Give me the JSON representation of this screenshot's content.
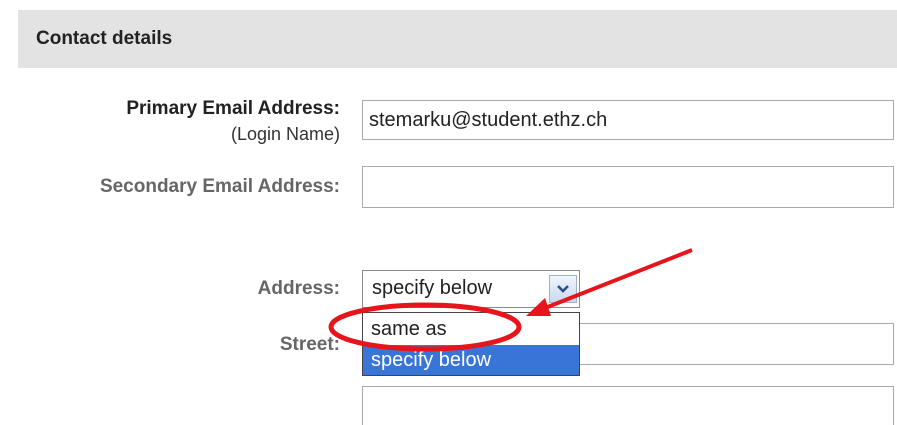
{
  "section": {
    "title": "Contact details"
  },
  "fields": {
    "primary_email": {
      "label": "Primary Email Address:",
      "sublabel": "(Login Name)",
      "value": "stemarku@student.ethz.ch"
    },
    "secondary_email": {
      "label": "Secondary Email Address:",
      "value": ""
    },
    "address": {
      "label": "Address:",
      "selected": "specify below",
      "options": [
        "same as",
        "specify below"
      ]
    },
    "street": {
      "label": "Street:",
      "value": "",
      "value2": ""
    }
  },
  "annotation": {
    "color": "#e8141c"
  }
}
